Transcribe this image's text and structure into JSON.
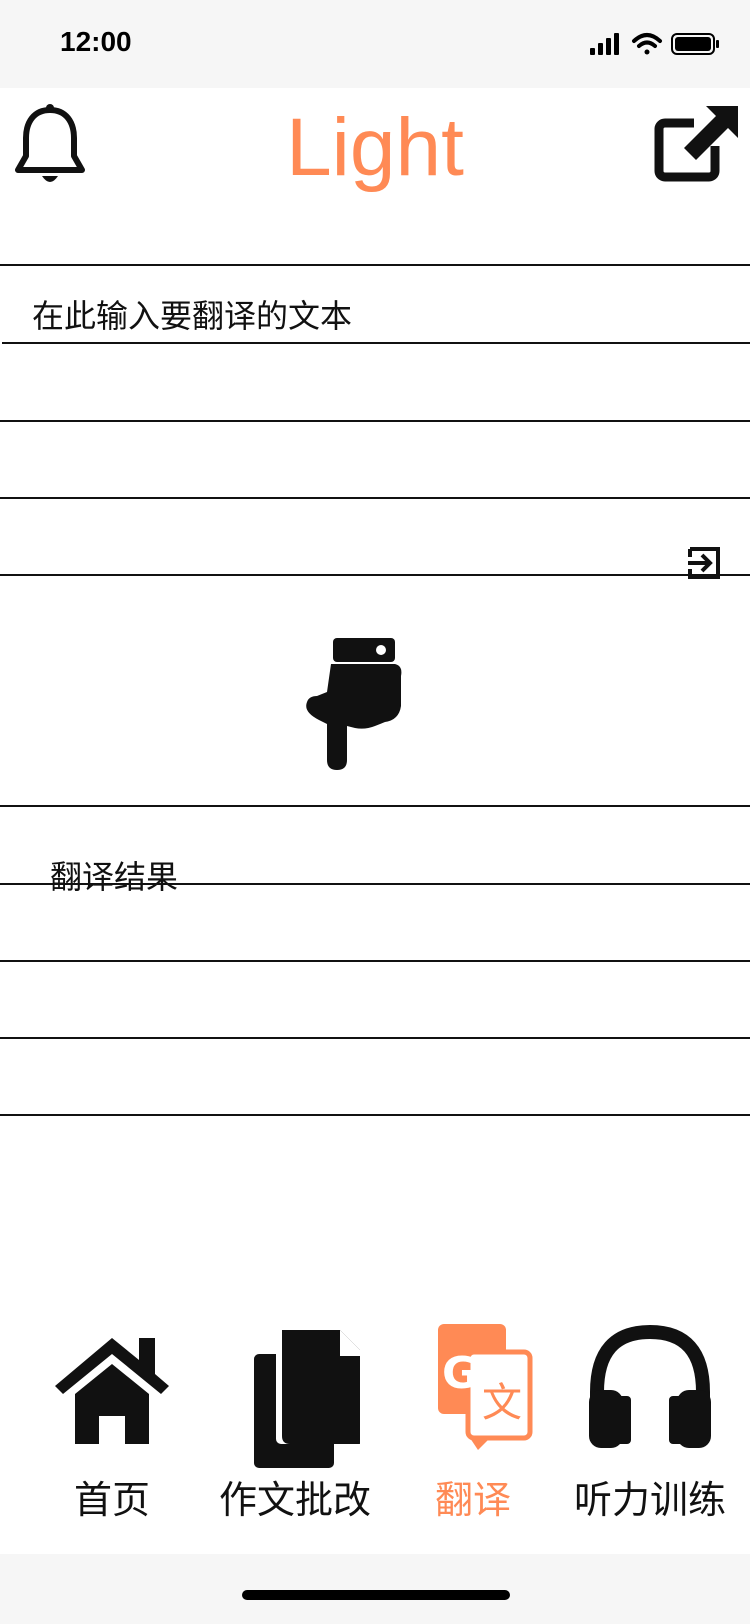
{
  "status_bar": {
    "time": "12:00"
  },
  "header": {
    "title": "Light",
    "title_color": "#FF8A55",
    "notification_icon": "bell-icon",
    "share_icon": "share-icon"
  },
  "translator": {
    "input_placeholder": "在此输入要翻译的文本",
    "submit_icon": "enter-icon",
    "arrow_icon": "pointing-down-hand-icon",
    "result_label": "翻译结果"
  },
  "tab_bar": {
    "active_color": "#FF8A55",
    "tabs": [
      {
        "label": "首页",
        "icon": "home-icon",
        "active": false
      },
      {
        "label": "作文批改",
        "icon": "document-icon",
        "active": false
      },
      {
        "label": "翻译",
        "icon": "translate-icon",
        "active": true
      },
      {
        "label": "听力训练",
        "icon": "headphones-icon",
        "active": false
      }
    ]
  }
}
